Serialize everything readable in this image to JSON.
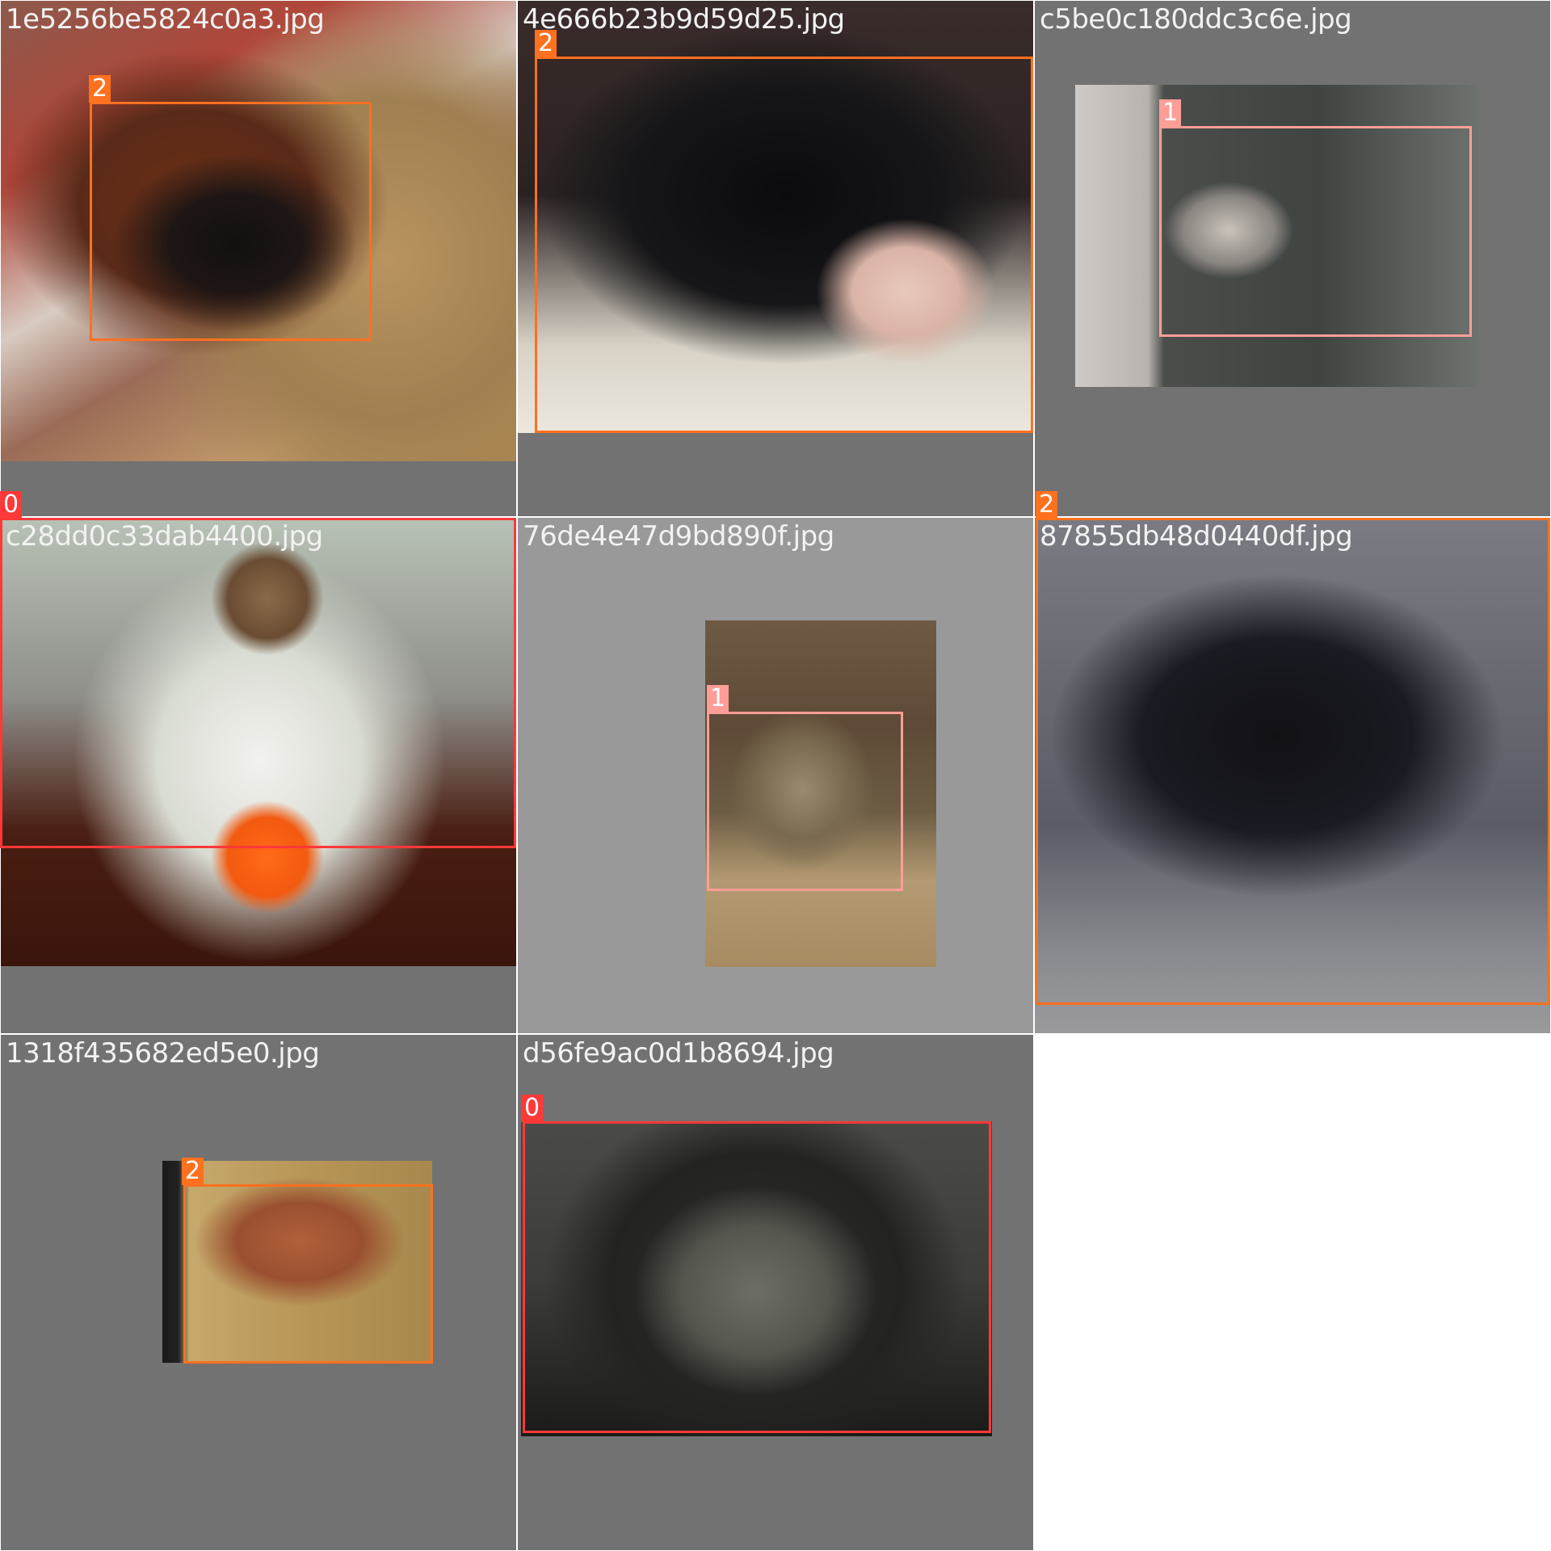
{
  "tiles": [
    {
      "filename": "1e5256be5824c0a3.jpg",
      "labels": [
        "2"
      ]
    },
    {
      "filename": "4e666b23b9d59d25.jpg",
      "labels": [
        "2"
      ]
    },
    {
      "filename": "c5be0c180ddc3c6e.jpg",
      "labels": [
        "1"
      ]
    },
    {
      "filename": "c28dd0c33dab4400.jpg",
      "labels": [
        "0"
      ]
    },
    {
      "filename": "76de4e47d9bd890f.jpg",
      "labels": [
        "1"
      ]
    },
    {
      "filename": "87855db48d0440df.jpg",
      "labels": [
        "2"
      ]
    },
    {
      "filename": "1318f435682ed5e0.jpg",
      "labels": [
        "2"
      ]
    },
    {
      "filename": "d56fe9ac0d1b8694.jpg",
      "labels": [
        "0"
      ]
    }
  ],
  "colors": {
    "class_0": "#ff3838",
    "class_1": "#ff9d97",
    "class_2": "#ff701f",
    "tile_bg": "#727272"
  }
}
